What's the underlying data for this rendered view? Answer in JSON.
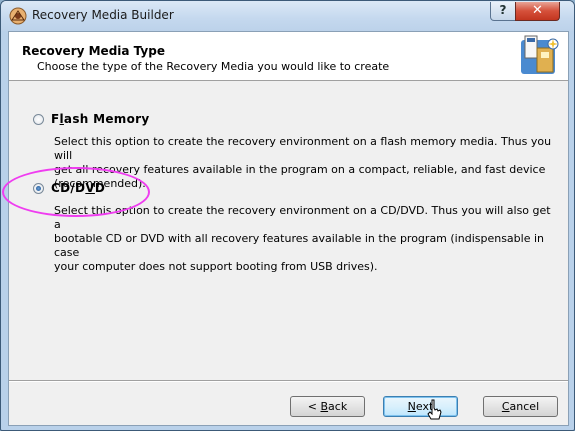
{
  "window": {
    "title": "Recovery Media Builder",
    "help_label": "?",
    "close_label": "✕"
  },
  "header": {
    "title": "Recovery Media Type",
    "subtitle": "Choose the type of the Recovery Media you would like to create",
    "icon": "recovery-media-wizard-icon"
  },
  "options": [
    {
      "label_pre": "F",
      "label_u": "l",
      "label_post": "ash Memory",
      "selected": false,
      "desc_lines": [
        "Select this option to create the recovery environment on a flash memory media. Thus you will",
        "get all recovery features available in the program on a compact, reliable, and fast device",
        "(recommended)."
      ]
    },
    {
      "label_pre": "CD/D",
      "label_u": "V",
      "label_post": "D",
      "selected": true,
      "desc_lines": [
        "Select this option to create the recovery environment on a CD/DVD. Thus you will also get a",
        "bootable CD or DVD with all recovery features available in the program (indispensable in case",
        "your computer does not support booting from USB drives)."
      ]
    }
  ],
  "buttons": {
    "back_pre": "< ",
    "back_u": "B",
    "back_post": "ack",
    "next_u": "N",
    "next_post": "ext",
    "cancel_u": "C",
    "cancel_post": "ancel"
  },
  "colors": {
    "highlight": "#ef3df0",
    "titlebar": "#c4d8ee"
  }
}
